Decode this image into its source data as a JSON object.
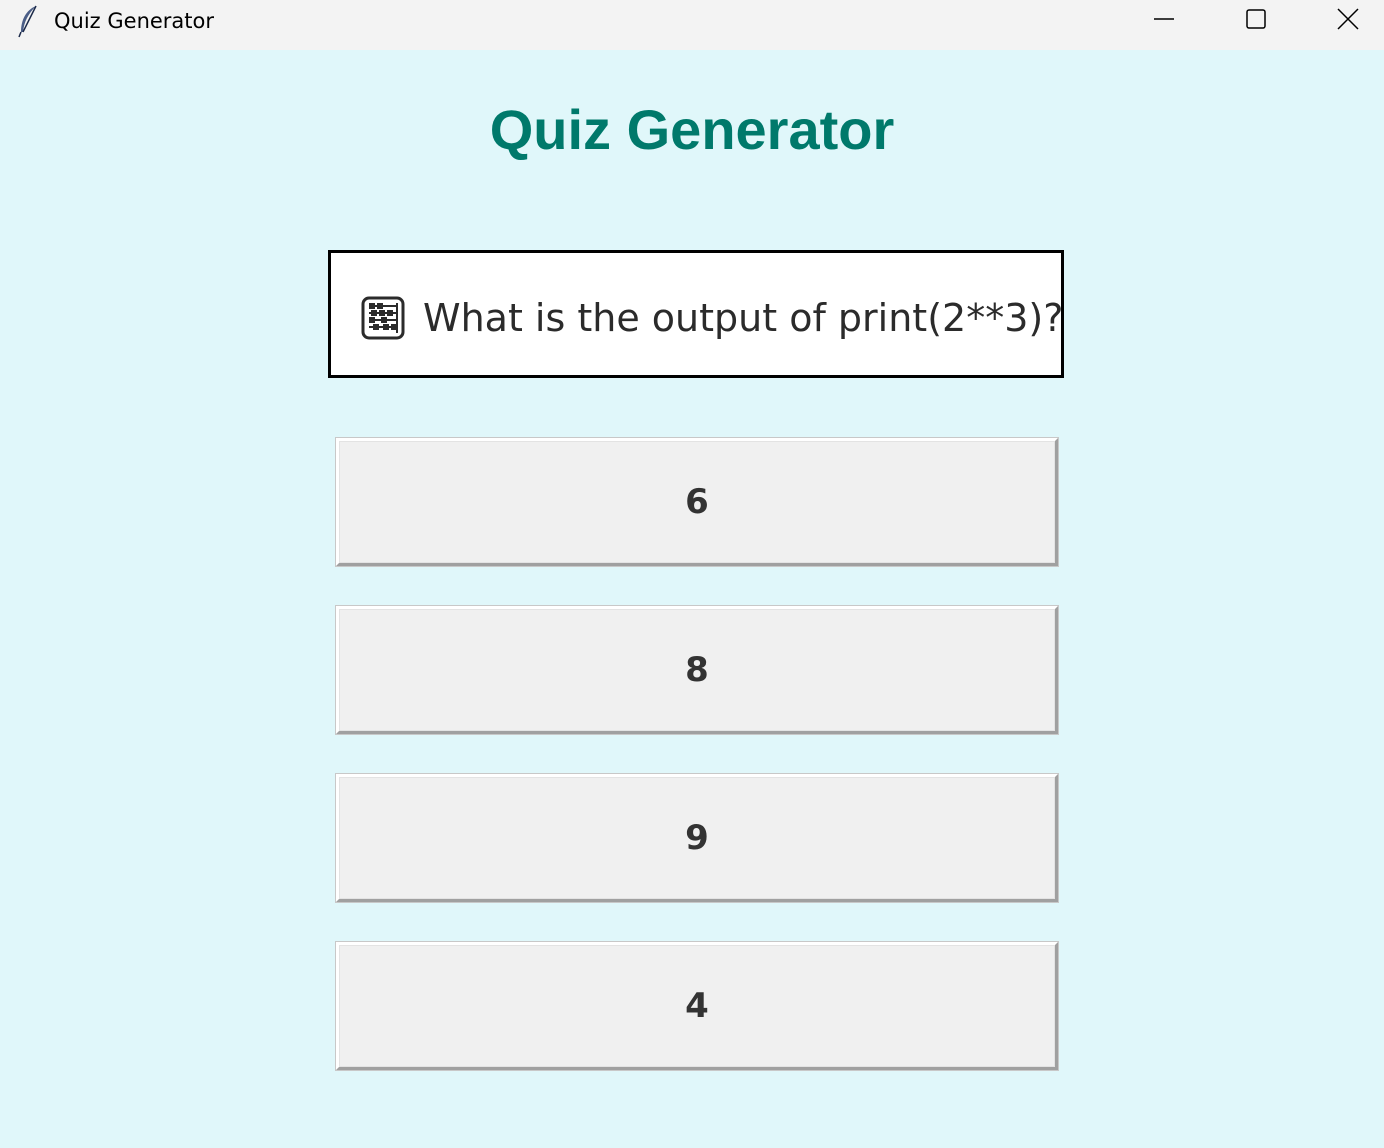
{
  "window": {
    "title": "Quiz Generator",
    "app_icon": "feather-icon",
    "controls": {
      "minimize_icon": "minimize-icon",
      "maximize_icon": "maximize-icon",
      "close_icon": "close-icon"
    }
  },
  "main": {
    "heading": "Quiz Generator",
    "question": {
      "icon": "abacus-icon",
      "text": "What is the output of print(2**3)?"
    },
    "answers": [
      {
        "label": "6"
      },
      {
        "label": "8"
      },
      {
        "label": "9"
      },
      {
        "label": "4"
      }
    ]
  },
  "colors": {
    "background": "#e0f7fa",
    "heading": "#00796b",
    "titlebar": "#f3f3f3",
    "button_face": "#f0f0f0"
  }
}
